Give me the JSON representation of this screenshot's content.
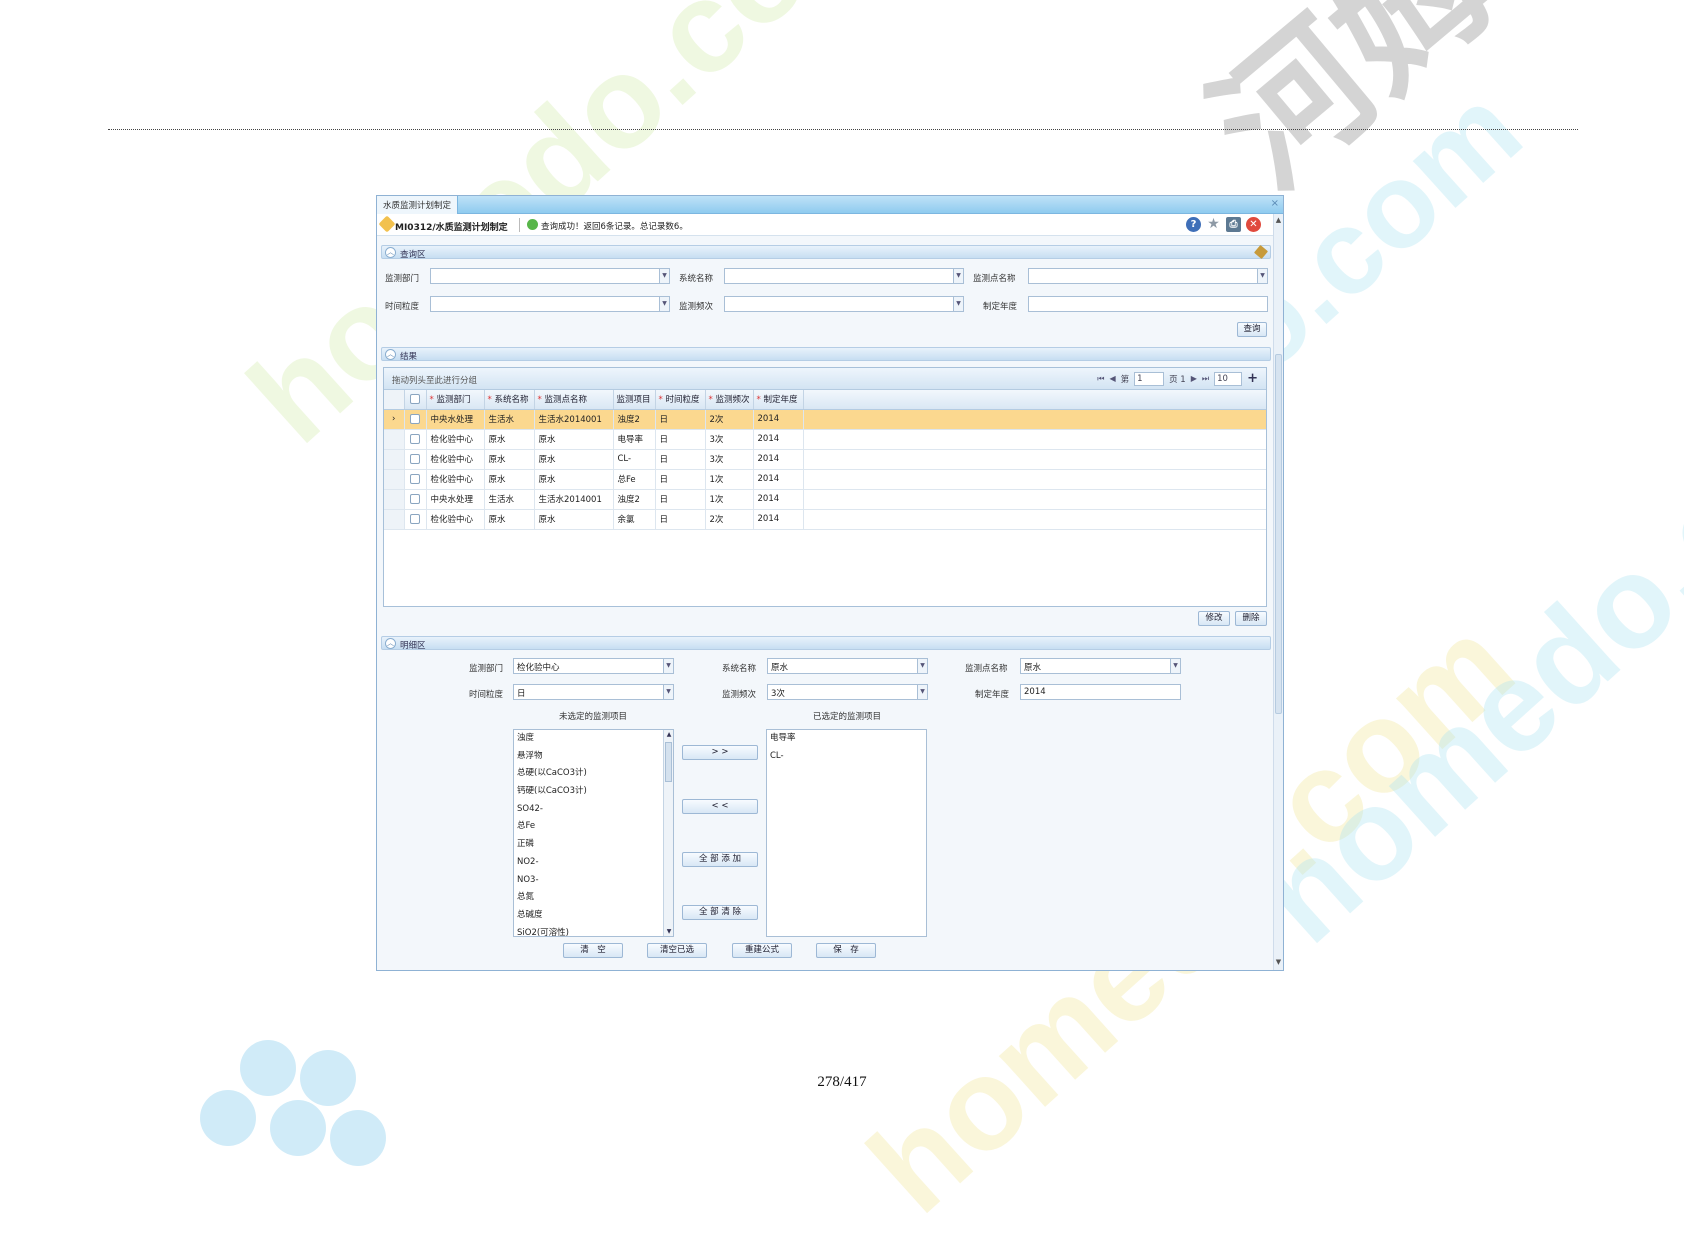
{
  "window": {
    "tab_label": "水质监测计划制定",
    "close_glyph": "×"
  },
  "toolbar": {
    "title": "MI0312/水质监测计划制定",
    "status": "查询成功！返回6条记录。总记录数6。",
    "help_glyph": "?",
    "star_glyph": "★",
    "print_glyph": "⎙",
    "close_glyph": "✕"
  },
  "query": {
    "section_label": "查询区",
    "dept_label": "监测部门",
    "system_label": "系统名称",
    "point_label": "监测点名称",
    "granularity_label": "时间粒度",
    "frequency_label": "监测频次",
    "year_label": "制定年度",
    "search_button": "查询"
  },
  "results": {
    "section_label": "结果",
    "group_hint": "拖动列头至此进行分组",
    "pager": {
      "first": "⏮",
      "prev": "◀",
      "page_prefix": "第",
      "page": "1",
      "page_suffix": "页 1",
      "next": "▶",
      "last": "⏭",
      "page_size": "10",
      "add": "+"
    },
    "columns": [
      "监测部门",
      "系统名称",
      "监测点名称",
      "监测项目",
      "时间粒度",
      "监测频次",
      "制定年度"
    ],
    "rows": [
      {
        "dept": "中央水处理",
        "system": "生活水",
        "point": "生活水2014001",
        "item": "浊度2",
        "granularity": "日",
        "frequency": "2次",
        "year": "2014"
      },
      {
        "dept": "检化验中心",
        "system": "原水",
        "point": "原水",
        "item": "电导率",
        "granularity": "日",
        "frequency": "3次",
        "year": "2014"
      },
      {
        "dept": "检化验中心",
        "system": "原水",
        "point": "原水",
        "item": "CL-",
        "granularity": "日",
        "frequency": "3次",
        "year": "2014"
      },
      {
        "dept": "检化验中心",
        "system": "原水",
        "point": "原水",
        "item": "总Fe",
        "granularity": "日",
        "frequency": "1次",
        "year": "2014"
      },
      {
        "dept": "中央水处理",
        "system": "生活水",
        "point": "生活水2014001",
        "item": "浊度2",
        "granularity": "日",
        "frequency": "1次",
        "year": "2014"
      },
      {
        "dept": "检化验中心",
        "system": "原水",
        "point": "原水",
        "item": "余氯",
        "granularity": "日",
        "frequency": "2次",
        "year": "2014"
      }
    ],
    "row_marker": "›",
    "edit_button": "修改",
    "delete_button": "删除"
  },
  "detail": {
    "section_label": "明细区",
    "dept_label": "监测部门",
    "dept_value": "检化验中心",
    "system_label": "系统名称",
    "system_value": "原水",
    "point_label": "监测点名称",
    "point_value": "原水",
    "granularity_label": "时间粒度",
    "granularity_value": "日",
    "frequency_label": "监测频次",
    "frequency_value": "3次",
    "year_label": "制定年度",
    "year_value": "2014",
    "unselected_caption": "未选定的监测项目",
    "selected_caption": "已选定的监测项目",
    "unselected_items": [
      "浊度",
      "悬浮物",
      "总硬(以CaCO3计)",
      "钙硬(以CaCO3计)",
      "SO42-",
      "总Fe",
      "正磷",
      "NO2-",
      "NO3-",
      "总氮",
      "总碱度",
      "SiO2(可溶性)"
    ],
    "selected_items": [
      "电导率",
      "CL-"
    ],
    "add_button": "> >",
    "remove_button": "< <",
    "add_all_button": "全 部 添 加",
    "remove_all_button": "全 部 清 除",
    "clear_button": "清　空",
    "clear_selected_button": "清空已选",
    "rebuild_button": "重建公式",
    "save_button": "保　存"
  },
  "page": {
    "number": "278/417"
  },
  "colors": {
    "selected_row": "#fbd88f",
    "header_gradient_top": "#bfe2f7",
    "header_gradient_bottom": "#8fcbef",
    "status_ok": "#58b64a"
  }
}
